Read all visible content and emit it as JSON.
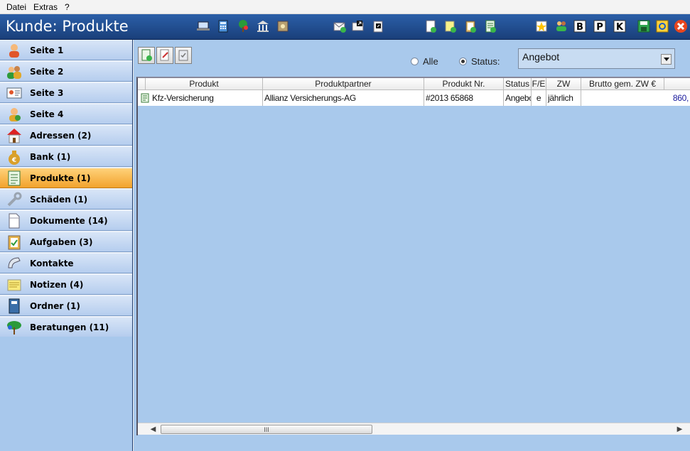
{
  "menu": {
    "items": [
      "Datei",
      "Extras",
      "?"
    ]
  },
  "window": {
    "title": "Kunde: Produkte"
  },
  "toolbar_icons": [
    "laptop-icon",
    "calculator-icon",
    "tree-icon",
    "bank-icon",
    "safe-icon",
    "mail-add-icon",
    "mail-send-icon",
    "fax-icon",
    "doc-add-icon",
    "doc-edit-icon",
    "clipboard-icon",
    "doc-list-icon",
    "star-icon",
    "users-icon",
    "b-icon",
    "p-icon",
    "k-icon",
    "save-icon",
    "refresh-icon",
    "close-icon"
  ],
  "sidebar": {
    "items": [
      {
        "label": "Seite 1",
        "icon": "person-icon",
        "active": false
      },
      {
        "label": "Seite 2",
        "icon": "people-icon",
        "active": false
      },
      {
        "label": "Seite 3",
        "icon": "id-card-icon",
        "active": false
      },
      {
        "label": "Seite 4",
        "icon": "person-group-icon",
        "active": false
      },
      {
        "label": "Adressen (2)",
        "icon": "house-icon",
        "active": false
      },
      {
        "label": "Bank (1)",
        "icon": "money-bag-icon",
        "active": false
      },
      {
        "label": "Produkte (1)",
        "icon": "product-list-icon",
        "active": true
      },
      {
        "label": "Schäden (1)",
        "icon": "wrench-icon",
        "active": false
      },
      {
        "label": "Dokumente (14)",
        "icon": "document-icon",
        "active": false
      },
      {
        "label": "Aufgaben (3)",
        "icon": "task-clipboard-icon",
        "active": false
      },
      {
        "label": "Kontakte",
        "icon": "phone-icon",
        "active": false
      },
      {
        "label": "Notizen (4)",
        "icon": "notes-icon",
        "active": false
      },
      {
        "label": "Ordner (1)",
        "icon": "folder-binder-icon",
        "active": false
      },
      {
        "label": "Beratungen (11)",
        "icon": "tree-icon",
        "active": false
      }
    ]
  },
  "filter": {
    "all_label": "Alle",
    "status_label": "Status:",
    "selected": "status",
    "status_value": "Angebot"
  },
  "grid": {
    "columns": [
      "Produkt",
      "Produktpartner",
      "Produkt Nr.",
      "Status",
      "F/E",
      "ZW",
      "Brutto gem. ZW €"
    ],
    "rows": [
      [
        "Kfz-Versicherung",
        "Allianz Versicherungs-AG",
        "#2013 65868",
        "Angebo",
        "e",
        "jährlich",
        "860,"
      ]
    ]
  },
  "scroll": {
    "thumb_mark": "III"
  },
  "colors": {
    "title_bar": "#2b5fa8",
    "active_tab": "#f2a32d",
    "panel": "#a9c9ec"
  }
}
